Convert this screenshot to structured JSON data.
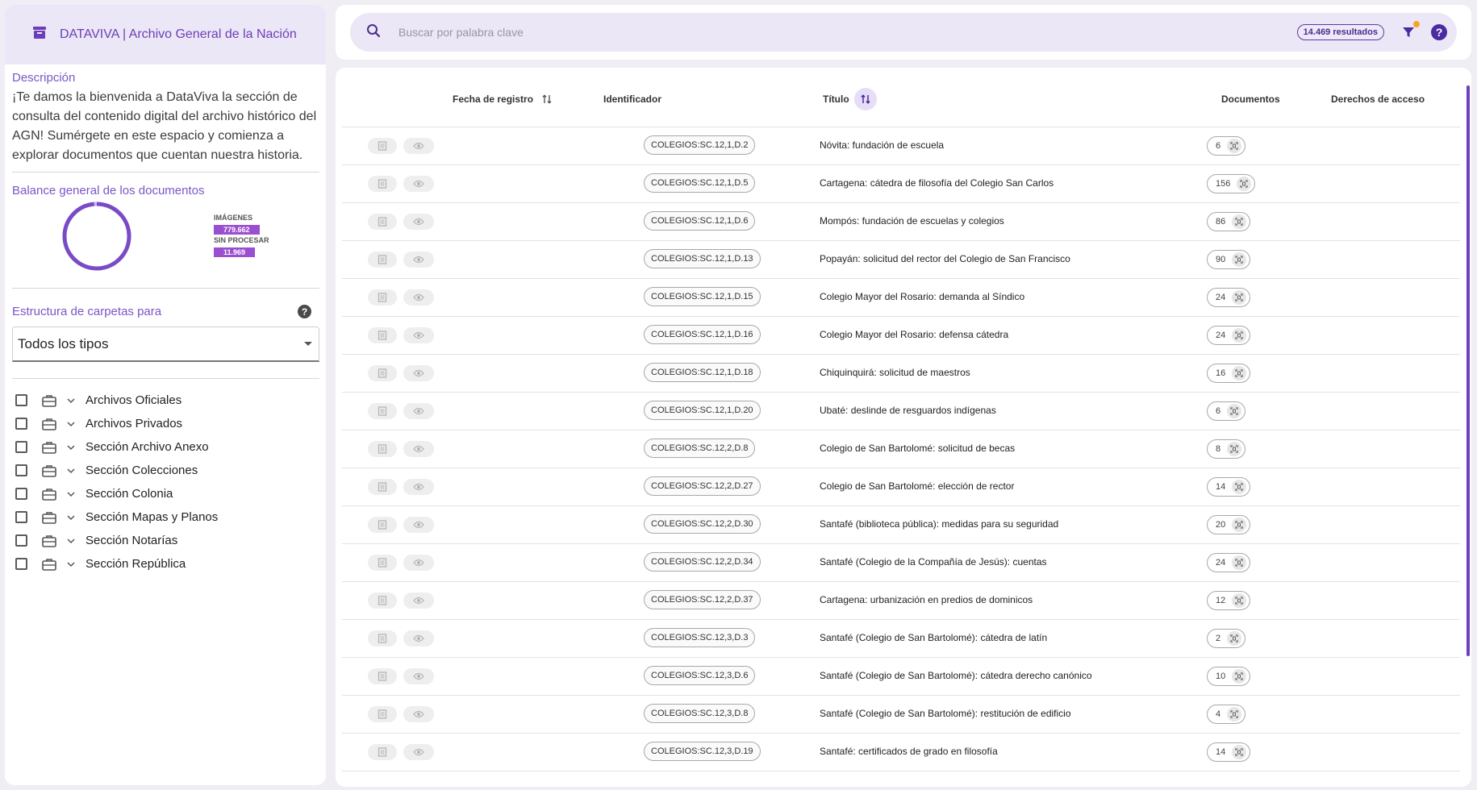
{
  "app": {
    "title": "DATAVIVA | Archivo General de la Nación"
  },
  "sidebar": {
    "description_title": "Descripción",
    "description_text": "¡Te damos la bienvenida a DataViva la sección de consulta del contenido digital del archivo histórico del AGN! Sumérgete en este espacio y comienza a explorar documentos que cuentan nuestra historia.",
    "balance_title": "Balance general de los documentos",
    "balance": {
      "images_label": "IMÁGENES",
      "images_value": "779.662",
      "unprocessed_label": "SIN PROCESAR",
      "unprocessed_value": "11.969",
      "images_fraction": 0.985,
      "color_images": "#7a4bc6",
      "color_unprocessed": "#c9b6ee"
    },
    "folder_title": "Estructura de carpetas para",
    "folder_select_value": "Todos los tipos",
    "tree": [
      {
        "label": "Archivos Oficiales"
      },
      {
        "label": "Archivos Privados"
      },
      {
        "label": "Sección Archivo Anexo"
      },
      {
        "label": "Sección Colecciones"
      },
      {
        "label": "Sección Colonia"
      },
      {
        "label": "Sección Mapas y Planos"
      },
      {
        "label": "Sección Notarías"
      },
      {
        "label": "Sección República"
      }
    ]
  },
  "search": {
    "placeholder": "Buscar por palabra clave",
    "results_badge": "14.469 resultados"
  },
  "table": {
    "headers": {
      "fecha": "Fecha de registro",
      "identificador": "Identificador",
      "titulo": "Título",
      "documentos": "Documentos",
      "derechos": "Derechos de acceso"
    },
    "rows": [
      {
        "id": "COLEGIOS:SC.12,1,D.2",
        "title": "Nóvita: fundación de escuela",
        "docs": "6"
      },
      {
        "id": "COLEGIOS:SC.12,1,D.5",
        "title": "Cartagena: cátedra de filosofía del Colegio San Carlos",
        "docs": "156"
      },
      {
        "id": "COLEGIOS:SC.12,1,D.6",
        "title": "Mompós: fundación de escuelas y colegios",
        "docs": "86"
      },
      {
        "id": "COLEGIOS:SC.12,1,D.13",
        "title": "Popayán: solicitud del rector del Colegio de San Francisco",
        "docs": "90"
      },
      {
        "id": "COLEGIOS:SC.12,1,D.15",
        "title": "Colegio Mayor del Rosario: demanda al Síndico",
        "docs": "24"
      },
      {
        "id": "COLEGIOS:SC.12,1,D.16",
        "title": "Colegio Mayor del Rosario: defensa cátedra",
        "docs": "24"
      },
      {
        "id": "COLEGIOS:SC.12,1,D.18",
        "title": "Chiquinquirá: solicitud de maestros",
        "docs": "16"
      },
      {
        "id": "COLEGIOS:SC.12,1,D.20",
        "title": "Ubaté: deslinde de resguardos indígenas",
        "docs": "6"
      },
      {
        "id": "COLEGIOS:SC.12,2,D.8",
        "title": "Colegio de San Bartolomé: solicitud de becas",
        "docs": "8"
      },
      {
        "id": "COLEGIOS:SC.12,2,D.27",
        "title": "Colegio de San Bartolomé: elección de rector",
        "docs": "14"
      },
      {
        "id": "COLEGIOS:SC.12,2,D.30",
        "title": "Santafé (biblioteca pública): medidas para su seguridad",
        "docs": "20"
      },
      {
        "id": "COLEGIOS:SC.12,2,D.34",
        "title": "Santafé (Colegio de la Compañía de Jesús): cuentas",
        "docs": "24"
      },
      {
        "id": "COLEGIOS:SC.12,2,D.37",
        "title": "Cartagena: urbanización en predios de dominicos",
        "docs": "12"
      },
      {
        "id": "COLEGIOS:SC.12,3,D.3",
        "title": "Santafé (Colegio de San Bartolomé): cátedra de latín",
        "docs": "2"
      },
      {
        "id": "COLEGIOS:SC.12,3,D.6",
        "title": "Santafé (Colegio de San Bartolomé): cátedra derecho canónico",
        "docs": "10"
      },
      {
        "id": "COLEGIOS:SC.12,3,D.8",
        "title": "Santafé (Colegio de San Bartolomé): restitución de edificio",
        "docs": "4"
      },
      {
        "id": "COLEGIOS:SC.12,3,D.19",
        "title": "Santafé: certificados de grado en filosofía",
        "docs": "14"
      }
    ]
  }
}
